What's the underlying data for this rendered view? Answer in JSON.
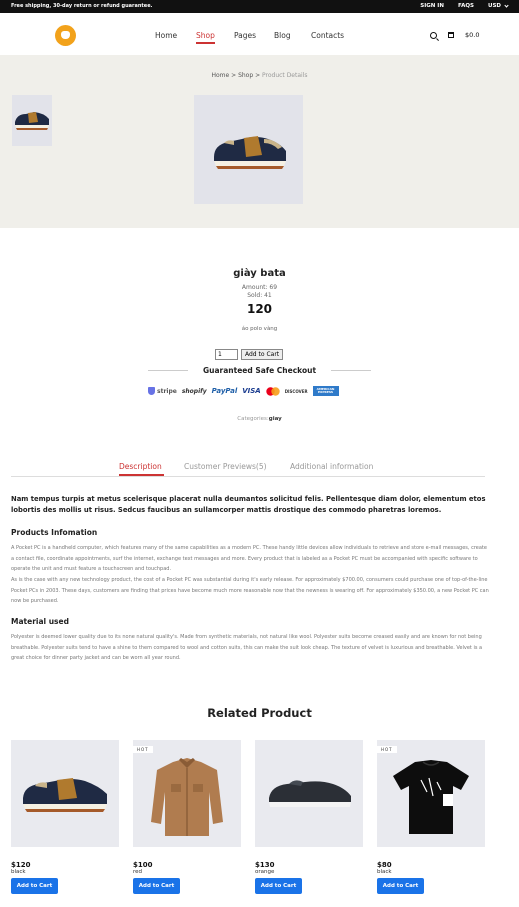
{
  "topbar": {
    "promo": "Free shipping, 30-day return or refund guarantee.",
    "signin": "SIGN IN",
    "faqs": "FAQS",
    "currency": "USD"
  },
  "header": {
    "nav": [
      "Home",
      "Shop",
      "Pages",
      "Blog",
      "Contacts"
    ],
    "active_nav": "Shop",
    "cart_total": "$0.0"
  },
  "breadcrumb": {
    "home": "Home",
    "shop": "Shop",
    "current": "Product Details"
  },
  "product": {
    "name": "giày bata",
    "amount": "Amount: 69",
    "sold": "Sold: 41",
    "price": "120",
    "short_desc": "áo polo vàng",
    "qty": "1",
    "add_label": "Add to Cart",
    "checkout_title": "Guaranteed Safe Checkout",
    "payments": [
      "stripe",
      "shopify",
      "PayPal",
      "VISA",
      "mastercard",
      "DISCOVER",
      "AMERICAN EXPRESS"
    ],
    "categories_label": "Categories:",
    "category": "giay"
  },
  "tabs": {
    "description": "Description",
    "reviews": "Customer Previews(5)",
    "additional": "Additional information"
  },
  "content": {
    "lead": "Nam tempus turpis at metus scelerisque placerat nulla deumantos solicitud felis. Pellentesque diam dolor, elementum etos lobortis des mollis ut risus. Sedcus faucibus an sullamcorper mattis drostique des commodo pharetras loremos.",
    "info_heading": "Products Infomation",
    "info_p1": "A Pocket PC is a handheld computer, which features many of the same capabilities as a modern PC. These handy little devices allow individuals to retrieve and store e-mail messages, create a contact file, coordinate appointments, surf the internet, exchange text messages and more. Every product that is labeled as a Pocket PC must be accompanied with specific software to operate the unit and must feature a touchscreen and touchpad.",
    "info_p2": "As is the case with any new technology product, the cost of a Pocket PC was substantial during it's early release. For approximately $700.00, consumers could purchase one of top-of-the-line Pocket PCs in 2003. These days, customers are finding that prices have become much more reasonable now that the newness is wearing off. For approximately $350.00, a new Pocket PC can now be purchased.",
    "material_heading": "Material used",
    "material_p": "Polyester is deemed lower quality due to its none natural quality's. Made from synthetic materials, not natural like wool. Polyester suits become creased easily and are known for not being breathable. Polyester suits tend to have a shine to them compared to wool and cotton suits, this can make the suit look cheap. The texture of velvet is luxurious and breathable. Velvet is a great choice for dinner party jacket and can be worn all year round."
  },
  "related": {
    "title": "Related Product",
    "items": [
      {
        "price": "$120",
        "color": "black",
        "hot": "",
        "button": "Add to Cart"
      },
      {
        "price": "$100",
        "color": "red",
        "hot": "HOT",
        "button": "Add to Cart"
      },
      {
        "price": "$130",
        "color": "orange",
        "hot": "",
        "button": "Add to Cart"
      },
      {
        "price": "$80",
        "color": "black",
        "hot": "HOT",
        "button": "Add to Cart"
      }
    ]
  }
}
